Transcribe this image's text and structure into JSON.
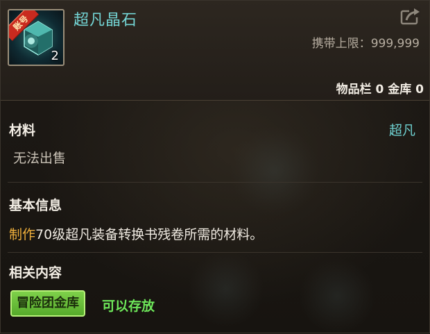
{
  "item": {
    "name": "超凡晶石",
    "badge": "账号",
    "count": "2",
    "icon": "crystal-gem-icon"
  },
  "header": {
    "limit_label": "携带上限：",
    "limit_value": "999,999",
    "storage": "物品栏 0 金库 0"
  },
  "sections": {
    "material": {
      "title": "材料",
      "grade": "超凡",
      "note": "无法出售"
    },
    "basic": {
      "title": "基本信息",
      "desc_highlight": "制作",
      "desc_rest": "70级超凡装备转换书残卷所需的材料。"
    },
    "related": {
      "title": "相关内容",
      "tag_label": "冒险团金库",
      "tag_text": "可以存放"
    }
  },
  "colors": {
    "title": "#74d6d6",
    "grade": "#6fd2d2",
    "highlight": "#f0b03c",
    "tag_bg": "#6cc23d",
    "tag_text": "#6ee85a"
  }
}
